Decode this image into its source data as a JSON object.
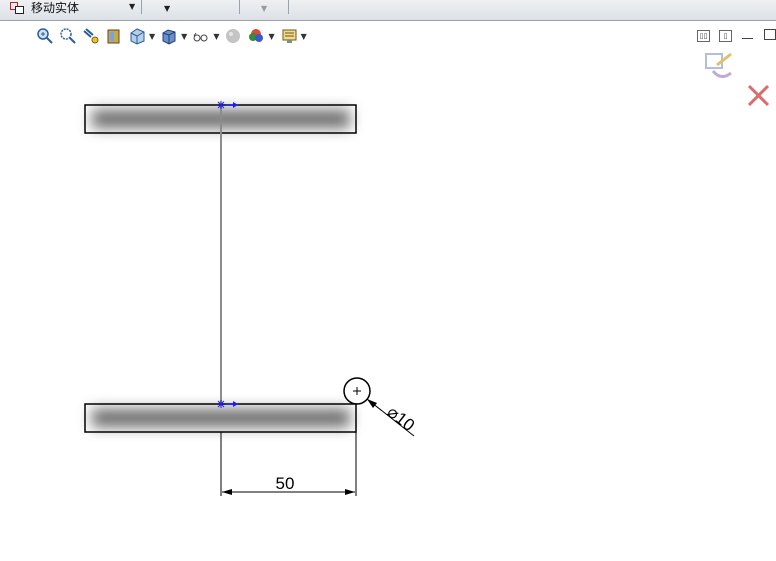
{
  "toolbar": {
    "command_label": "移动实体",
    "command_icon": "move-entities-icon"
  },
  "view_toolbar": {
    "buttons": [
      {
        "icon": "zoom-to-fit-icon"
      },
      {
        "icon": "zoom-to-area-icon"
      },
      {
        "icon": "previous-view-icon"
      },
      {
        "icon": "section-view-icon"
      },
      {
        "icon": "view-orientation-icon",
        "dropdown": true
      },
      {
        "icon": "display-style-icon",
        "dropdown": true
      },
      {
        "icon": "hide-show-items-icon",
        "dropdown": true
      },
      {
        "icon": "edit-appearance-icon"
      },
      {
        "icon": "apply-scene-icon",
        "dropdown": true
      },
      {
        "icon": "view-settings-icon",
        "dropdown": true
      }
    ]
  },
  "confirmation_corner": {
    "exit_sketch_icon": "exit-sketch-icon",
    "cancel_icon": "cancel-sketch-icon"
  },
  "sketch": {
    "linear_dimension": "50",
    "diameter_dimension": "⌀10"
  },
  "colors": {
    "sketch_line": "#000000",
    "relation_marker": "#1a1aff",
    "cancel_red": "#e06a6a"
  }
}
